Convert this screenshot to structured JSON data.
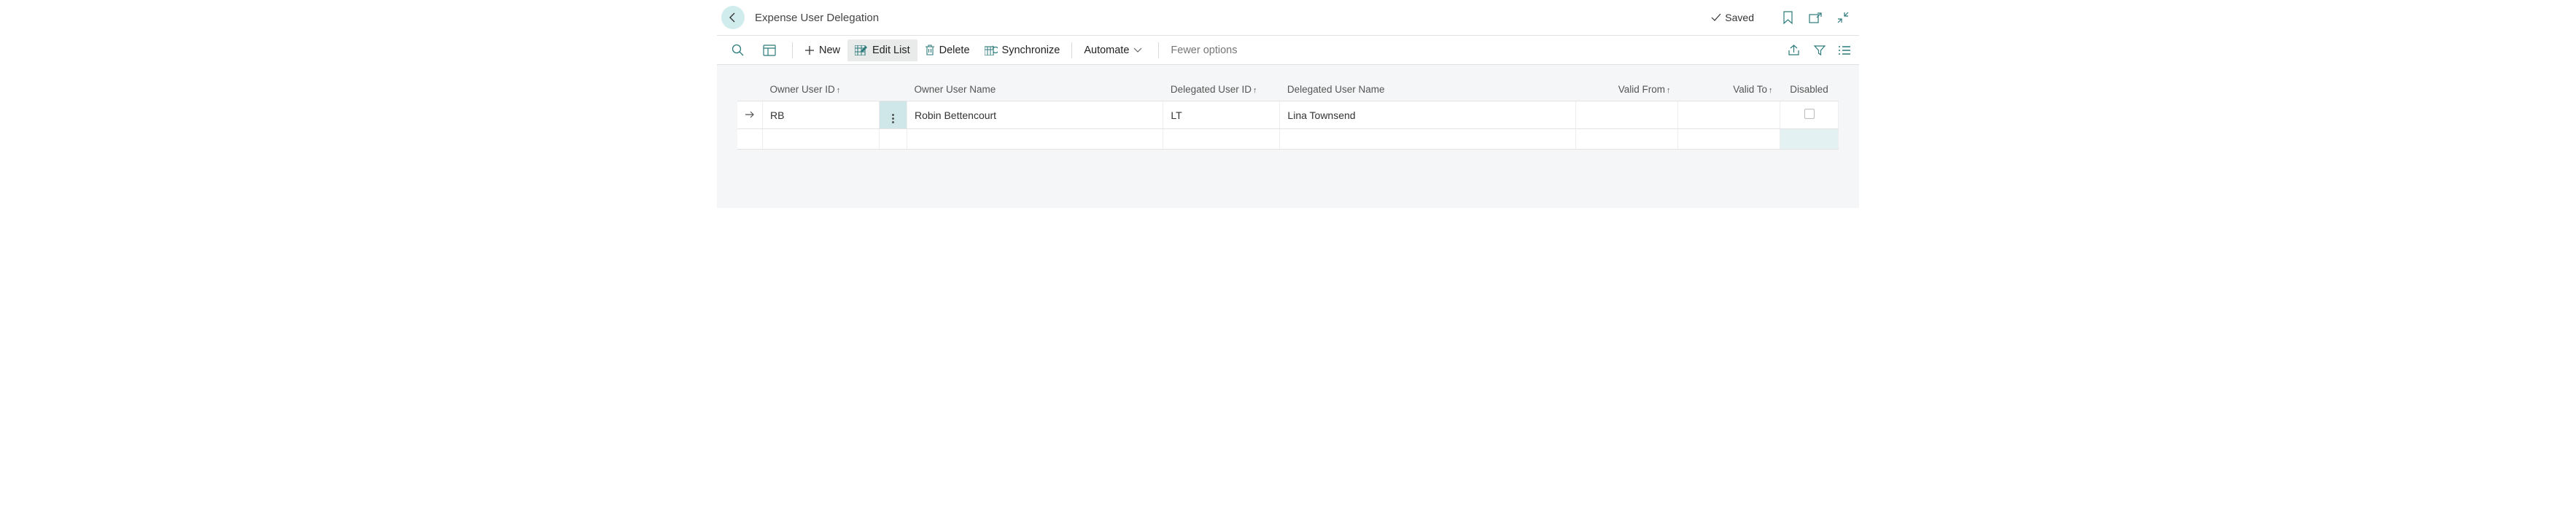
{
  "header": {
    "title": "Expense User Delegation",
    "saved_label": "Saved"
  },
  "toolbar": {
    "new_label": "New",
    "edit_list_label": "Edit List",
    "delete_label": "Delete",
    "synchronize_label": "Synchronize",
    "automate_label": "Automate",
    "fewer_options_label": "Fewer options"
  },
  "columns": {
    "owner_user_id": "Owner User ID",
    "owner_user_name": "Owner User Name",
    "delegated_user_id": "Delegated User ID",
    "delegated_user_name": "Delegated User Name",
    "valid_from": "Valid From",
    "valid_to": "Valid To",
    "disabled": "Disabled"
  },
  "rows": [
    {
      "owner_user_id": "RB",
      "owner_user_name": "Robin Bettencourt",
      "delegated_user_id": "LT",
      "delegated_user_name": "Lina Townsend",
      "valid_from": "",
      "valid_to": "",
      "disabled": false
    }
  ]
}
